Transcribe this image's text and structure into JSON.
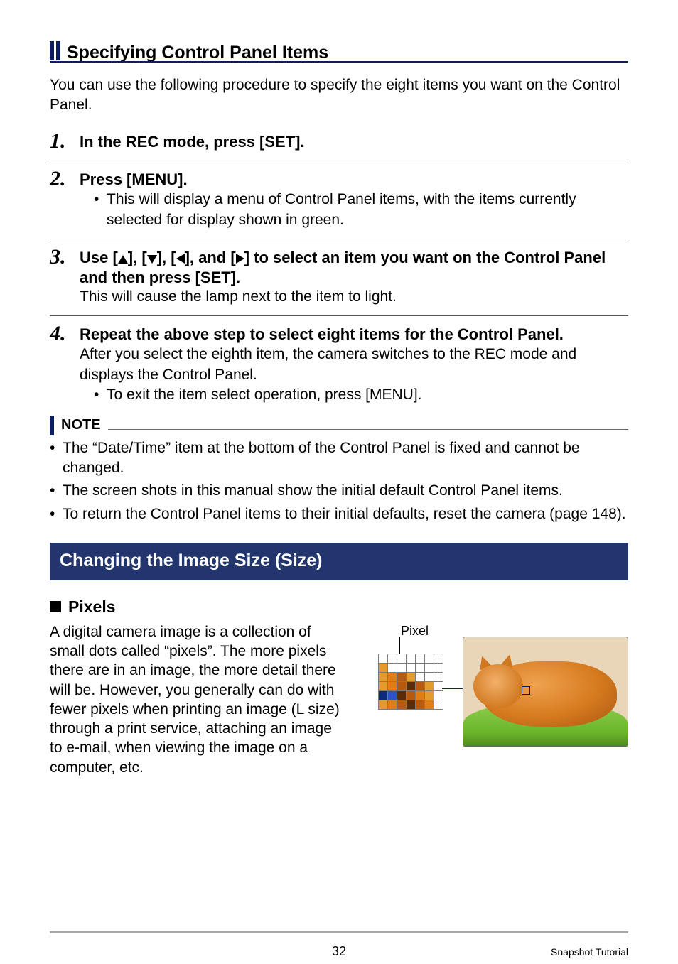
{
  "headings": {
    "specifying": "Specifying Control Panel Items",
    "changing": "Changing the Image Size (Size)",
    "pixels": "Pixels"
  },
  "intro": "You can use the following procedure to specify the eight items you want on the Control Panel.",
  "steps": {
    "s1": {
      "num": "1.",
      "title": "In the REC mode, press [SET]."
    },
    "s2": {
      "num": "2.",
      "title": "Press [MENU].",
      "bullet": "This will display a menu of Control Panel items, with the items currently selected for display shown in green."
    },
    "s3": {
      "num": "3.",
      "title_pre": "Use [",
      "title_mid1": "], [",
      "title_mid2": "], [",
      "title_mid3": "], and [",
      "title_post": "] to select an item you want on the Control Panel and then press [SET].",
      "after": "This will cause the lamp next to the item to light."
    },
    "s4": {
      "num": "4.",
      "title": "Repeat the above step to select eight items for the Control Panel.",
      "after": "After you select the eighth item, the camera switches to the REC mode and displays the Control Panel.",
      "bullet": "To exit the item select operation, press [MENU]."
    }
  },
  "note": {
    "label": "NOTE",
    "n1": "The “Date/Time” item at the bottom of the Control Panel is fixed and cannot be changed.",
    "n2": "The screen shots in this manual show the initial default Control Panel items.",
    "n3": "To return the Control Panel items to their initial defaults, reset the camera (page 148)."
  },
  "pixels_para": "A digital camera image is a collection of small dots called “pixels”. The more pixels there are in an image, the more detail there will be. However, you generally can do with fewer pixels when printing an image (L size) through a print service, attaching an image to e-mail, when viewing the image on a computer, etc.",
  "pixel_label": "Pixel",
  "pixel_colors": [
    [
      "#ffffff",
      "#ffffff",
      "#ffffff",
      "#ffffff",
      "#ffffff",
      "#ffffff",
      "#ffffff"
    ],
    [
      "#e59a2d",
      "#ffffff",
      "#ffffff",
      "#ffffff",
      "#ffffff",
      "#ffffff",
      "#ffffff"
    ],
    [
      "#e59a2d",
      "#e07d14",
      "#b65a0f",
      "#e59a2d",
      "#ffffff",
      "#ffffff",
      "#ffffff"
    ],
    [
      "#e59a2d",
      "#e07d14",
      "#b65a0f",
      "#5a2c08",
      "#b65a0f",
      "#e59a2d",
      "#ffffff"
    ],
    [
      "#0a2a7a",
      "#2a55c2",
      "#5a2c08",
      "#b65a0f",
      "#e07d14",
      "#e59a2d",
      "#ffffff"
    ],
    [
      "#e59a2d",
      "#e07d14",
      "#b65a0f",
      "#5a2c08",
      "#b65a0f",
      "#e07d14",
      "#ffffff"
    ]
  ],
  "footer": {
    "page": "32",
    "crumb": "Snapshot Tutorial"
  },
  "bullet": "•"
}
